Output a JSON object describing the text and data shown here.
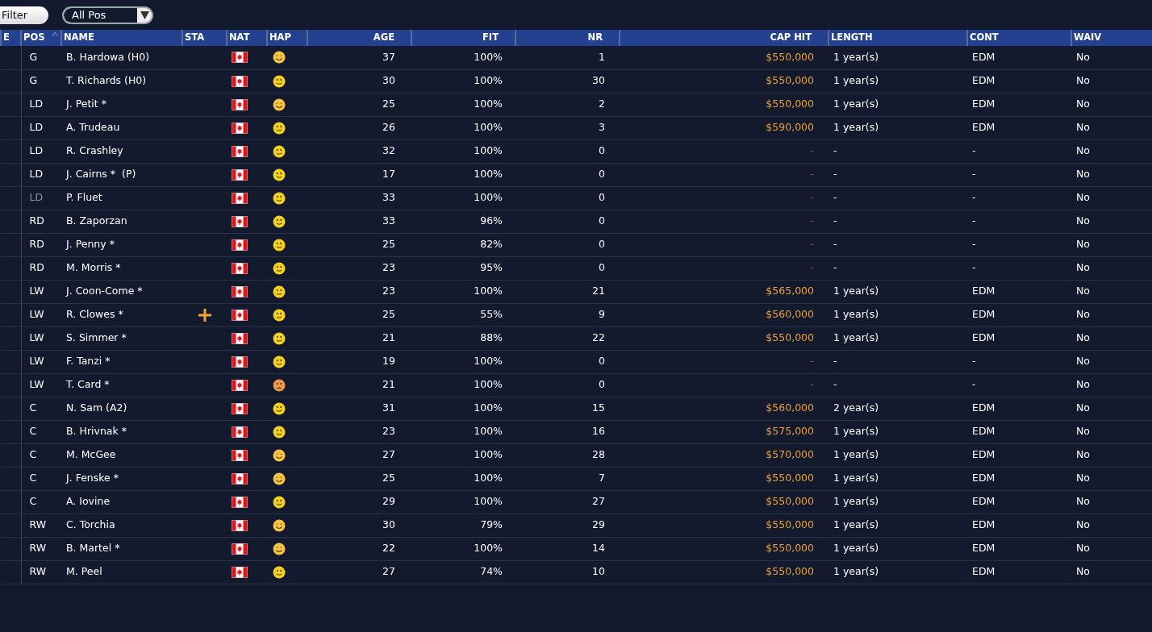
{
  "toolbar": {
    "filter_button": "Filter",
    "position_dropdown": "All Pos"
  },
  "columns": [
    {
      "label": "E",
      "sorted": false
    },
    {
      "label": "POS",
      "sorted": true
    },
    {
      "label": "NAME",
      "sorted": false
    },
    {
      "label": "STA",
      "sorted": false
    },
    {
      "label": "NAT",
      "sorted": false
    },
    {
      "label": "HAP",
      "sorted": false
    },
    {
      "label": "AGE",
      "sorted": false
    },
    {
      "label": "FIT",
      "sorted": false
    },
    {
      "label": "NR",
      "sorted": false
    },
    {
      "label": "CAP HIT",
      "sorted": false
    },
    {
      "label": "LENGTH",
      "sorted": false
    },
    {
      "label": "CONT",
      "sorted": false
    },
    {
      "label": "WAIV",
      "sorted": false
    }
  ],
  "rows": [
    {
      "pos": "G",
      "name": "B. Hardowa (H0)",
      "sta_mark": false,
      "hap": {
        "kind": "very_happy"
      },
      "age": "37",
      "fit": "100%",
      "nr": "1",
      "cap_hit": "$550,000",
      "signed": true,
      "length": "1 year(s)",
      "cont": "EDM",
      "waiv": "No",
      "dimmed": false
    },
    {
      "pos": "G",
      "name": "T. Richards (H0)",
      "sta_mark": false,
      "hap": {
        "kind": "happy"
      },
      "age": "30",
      "fit": "100%",
      "nr": "30",
      "cap_hit": "$550,000",
      "signed": true,
      "length": "1 year(s)",
      "cont": "EDM",
      "waiv": "No",
      "dimmed": false
    },
    {
      "pos": "LD",
      "name": "J. Petit *",
      "sta_mark": false,
      "hap": {
        "kind": "very_happy"
      },
      "age": "25",
      "fit": "100%",
      "nr": "2",
      "cap_hit": "$550,000",
      "signed": true,
      "length": "1 year(s)",
      "cont": "EDM",
      "waiv": "No",
      "dimmed": false
    },
    {
      "pos": "LD",
      "name": "A. Trudeau",
      "sta_mark": false,
      "hap": {
        "kind": "happy"
      },
      "age": "26",
      "fit": "100%",
      "nr": "3",
      "cap_hit": "$590,000",
      "signed": true,
      "length": "1 year(s)",
      "cont": "EDM",
      "waiv": "No",
      "dimmed": false
    },
    {
      "pos": "LD",
      "name": "R. Crashley",
      "sta_mark": false,
      "hap": {
        "kind": "happy"
      },
      "age": "32",
      "fit": "100%",
      "nr": "0",
      "cap_hit": "-",
      "signed": false,
      "length": "-",
      "cont": "-",
      "waiv": "No",
      "dimmed": false
    },
    {
      "pos": "LD",
      "name": "J. Cairns *  (P)",
      "sta_mark": false,
      "hap": {
        "kind": "happy"
      },
      "age": "17",
      "fit": "100%",
      "nr": "0",
      "cap_hit": "-",
      "signed": false,
      "length": "-",
      "cont": "-",
      "waiv": "No",
      "dimmed": false
    },
    {
      "pos": "LD",
      "name": "P. Fluet",
      "sta_mark": false,
      "hap": {
        "kind": "happy"
      },
      "age": "33",
      "fit": "100%",
      "nr": "0",
      "cap_hit": "-",
      "signed": false,
      "length": "-",
      "cont": "-",
      "waiv": "No",
      "dimmed": true
    },
    {
      "pos": "RD",
      "name": "B. Zaporzan",
      "sta_mark": false,
      "hap": {
        "kind": "happy"
      },
      "age": "33",
      "fit": "96%",
      "nr": "0",
      "cap_hit": "-",
      "signed": false,
      "length": "-",
      "cont": "-",
      "waiv": "No",
      "dimmed": false
    },
    {
      "pos": "RD",
      "name": "J. Penny *",
      "sta_mark": false,
      "hap": {
        "kind": "happy"
      },
      "age": "25",
      "fit": "82%",
      "nr": "0",
      "cap_hit": "-",
      "signed": false,
      "length": "-",
      "cont": "-",
      "waiv": "No",
      "dimmed": false
    },
    {
      "pos": "RD",
      "name": "M. Morris *",
      "sta_mark": false,
      "hap": {
        "kind": "happy"
      },
      "age": "23",
      "fit": "95%",
      "nr": "0",
      "cap_hit": "-",
      "signed": false,
      "length": "-",
      "cont": "-",
      "waiv": "No",
      "dimmed": false
    },
    {
      "pos": "LW",
      "name": "J. Coon-Come *",
      "sta_mark": false,
      "hap": {
        "kind": "happy"
      },
      "age": "23",
      "fit": "100%",
      "nr": "21",
      "cap_hit": "$565,000",
      "signed": true,
      "length": "1 year(s)",
      "cont": "EDM",
      "waiv": "No",
      "dimmed": false
    },
    {
      "pos": "LW",
      "name": "R. Clowes *",
      "sta_mark": true,
      "hap": {
        "kind": "happy"
      },
      "age": "25",
      "fit": "55%",
      "nr": "9",
      "cap_hit": "$560,000",
      "signed": true,
      "length": "1 year(s)",
      "cont": "EDM",
      "waiv": "No",
      "dimmed": false
    },
    {
      "pos": "LW",
      "name": "S. Simmer *",
      "sta_mark": false,
      "hap": {
        "kind": "happy"
      },
      "age": "21",
      "fit": "88%",
      "nr": "22",
      "cap_hit": "$550,000",
      "signed": true,
      "length": "1 year(s)",
      "cont": "EDM",
      "waiv": "No",
      "dimmed": false
    },
    {
      "pos": "LW",
      "name": "F. Tanzi *",
      "sta_mark": false,
      "hap": {
        "kind": "happy"
      },
      "age": "19",
      "fit": "100%",
      "nr": "0",
      "cap_hit": "-",
      "signed": false,
      "length": "-",
      "cont": "-",
      "waiv": "No",
      "dimmed": false
    },
    {
      "pos": "LW",
      "name": "T. Card *",
      "sta_mark": false,
      "hap": {
        "kind": "unhappy"
      },
      "age": "21",
      "fit": "100%",
      "nr": "0",
      "cap_hit": "-",
      "signed": false,
      "length": "-",
      "cont": "-",
      "waiv": "No",
      "dimmed": false
    },
    {
      "pos": "C",
      "name": "N. Sam (A2)",
      "sta_mark": false,
      "hap": {
        "kind": "happy"
      },
      "age": "31",
      "fit": "100%",
      "nr": "15",
      "cap_hit": "$560,000",
      "signed": true,
      "length": "2 year(s)",
      "cont": "EDM",
      "waiv": "No",
      "dimmed": false
    },
    {
      "pos": "C",
      "name": "B. Hrivnak *",
      "sta_mark": false,
      "hap": {
        "kind": "happy"
      },
      "age": "23",
      "fit": "100%",
      "nr": "16",
      "cap_hit": "$575,000",
      "signed": true,
      "length": "1 year(s)",
      "cont": "EDM",
      "waiv": "No",
      "dimmed": false
    },
    {
      "pos": "C",
      "name": "M. McGee",
      "sta_mark": false,
      "hap": {
        "kind": "very_happy"
      },
      "age": "27",
      "fit": "100%",
      "nr": "28",
      "cap_hit": "$570,000",
      "signed": true,
      "length": "1 year(s)",
      "cont": "EDM",
      "waiv": "No",
      "dimmed": false
    },
    {
      "pos": "C",
      "name": "J. Fenske *",
      "sta_mark": false,
      "hap": {
        "kind": "very_happy"
      },
      "age": "25",
      "fit": "100%",
      "nr": "7",
      "cap_hit": "$550,000",
      "signed": true,
      "length": "1 year(s)",
      "cont": "EDM",
      "waiv": "No",
      "dimmed": false
    },
    {
      "pos": "C",
      "name": "A. Iovine",
      "sta_mark": false,
      "hap": {
        "kind": "happy"
      },
      "age": "29",
      "fit": "100%",
      "nr": "27",
      "cap_hit": "$550,000",
      "signed": true,
      "length": "1 year(s)",
      "cont": "EDM",
      "waiv": "No",
      "dimmed": false
    },
    {
      "pos": "RW",
      "name": "C. Torchia",
      "sta_mark": false,
      "hap": {
        "kind": "very_happy"
      },
      "age": "30",
      "fit": "79%",
      "nr": "29",
      "cap_hit": "$550,000",
      "signed": true,
      "length": "1 year(s)",
      "cont": "EDM",
      "waiv": "No",
      "dimmed": false
    },
    {
      "pos": "RW",
      "name": "B. Martel *",
      "sta_mark": false,
      "hap": {
        "kind": "very_happy"
      },
      "age": "22",
      "fit": "100%",
      "nr": "14",
      "cap_hit": "$550,000",
      "signed": true,
      "length": "1 year(s)",
      "cont": "EDM",
      "waiv": "No",
      "dimmed": false
    },
    {
      "pos": "RW",
      "name": "M. Peel",
      "sta_mark": false,
      "hap": {
        "kind": "happy"
      },
      "age": "27",
      "fit": "74%",
      "nr": "10",
      "cap_hit": "$550,000",
      "signed": true,
      "length": "1 year(s)",
      "cont": "EDM",
      "waiv": "No",
      "dimmed": false
    }
  ]
}
